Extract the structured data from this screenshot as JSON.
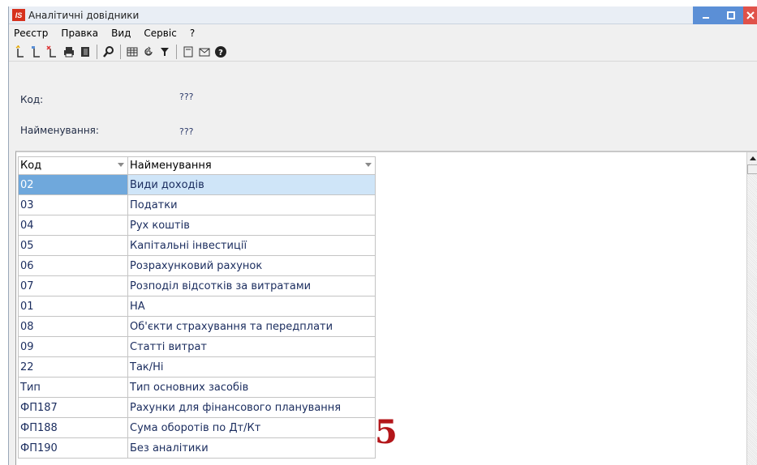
{
  "window": {
    "title": "Аналітичні довідники",
    "logo_text": "IS"
  },
  "menu": [
    "Реєстр",
    "Правка",
    "Вид",
    "Сервіс",
    "?"
  ],
  "toolbar": {
    "icons": [
      "new-record-icon",
      "copy-record-icon",
      "delete-record-icon",
      "print-icon",
      "export-icon",
      "search-icon",
      "table-view-icon",
      "refresh-icon",
      "filter-icon",
      "document-icon",
      "mail-icon",
      "help-icon"
    ]
  },
  "header": {
    "code_label": "Код:",
    "code_value": "???",
    "name_label": "Найменування:",
    "name_value": "???"
  },
  "grid": {
    "columns": [
      "Код",
      "Найменування"
    ],
    "rows": [
      {
        "code": "02",
        "name": "Види доходів"
      },
      {
        "code": "03",
        "name": "Податки"
      },
      {
        "code": "04",
        "name": "Рух коштів"
      },
      {
        "code": "05",
        "name": "Капітальні інвестиції"
      },
      {
        "code": "06",
        "name": "Розрахунковий рахунок"
      },
      {
        "code": "07",
        "name": "Розподіл відсотків за витратами"
      },
      {
        "code": "01",
        "name": "НА"
      },
      {
        "code": "08",
        "name": "Об'єкти страхування та передплати"
      },
      {
        "code": "09",
        "name": "Статті витрат"
      },
      {
        "code": "22",
        "name": "Так/Ні"
      },
      {
        "code": "Тип",
        "name": "Тип основних засобів"
      },
      {
        "code": "ФП187",
        "name": "Рахунки для фінансового планування"
      },
      {
        "code": "ФП188",
        "name": "Сума оборотів по Дт/Кт"
      },
      {
        "code": "ФП190",
        "name": "Без аналітики"
      }
    ],
    "selected_index": 0
  },
  "annotation": "5",
  "colors": {
    "selection": "#cfe5f8",
    "annotation": "#b3161a",
    "logo": "#d6321e"
  }
}
